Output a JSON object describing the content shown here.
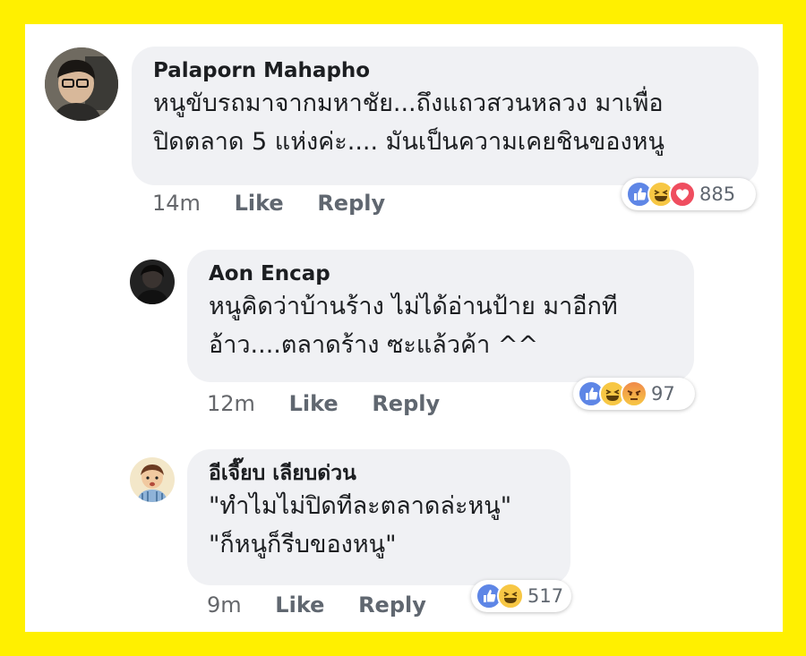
{
  "comments": [
    {
      "author": "Palaporn Mahapho",
      "lines": [
        "หนูขับรถมาจากมหาชัย...ถึงแถวสวนหลวง มาเพื่อ",
        "ปิดตลาด 5 แห่งค่ะ....  มันเป็นความเคยชินของหนู"
      ],
      "time": "14m",
      "like_label": "Like",
      "reply_label": "Reply",
      "reactions": [
        "like-icon",
        "haha-icon",
        "love-icon"
      ],
      "reaction_count": "885"
    },
    {
      "author": "Aon Encap",
      "lines": [
        "หนูคิดว่าบ้านร้าง ไม่ได้อ่านป้าย มาอีกที",
        "อ้าว....ตลาดร้าง ซะแล้วค้า ^^"
      ],
      "time": "12m",
      "like_label": "Like",
      "reply_label": "Reply",
      "reactions": [
        "like-icon",
        "haha-icon",
        "angry-icon"
      ],
      "reaction_count": "97"
    },
    {
      "author": "อีเจี๊ยบ เลียบด่วน",
      "lines": [
        "\"ทำไมไม่ปิดทีละตลาดล่ะหนู\"",
        "\"ก็หนูก็รีบของหนู\""
      ],
      "time": "9m",
      "like_label": "Like",
      "reply_label": "Reply",
      "reactions": [
        "like-icon",
        "haha-icon"
      ],
      "reaction_count": "517"
    }
  ],
  "colors": {
    "frame": "#fff000",
    "bubble": "#f0f1f4",
    "like": "#5e86e6",
    "haha": "#f7c744",
    "love": "#ef4d5f"
  }
}
